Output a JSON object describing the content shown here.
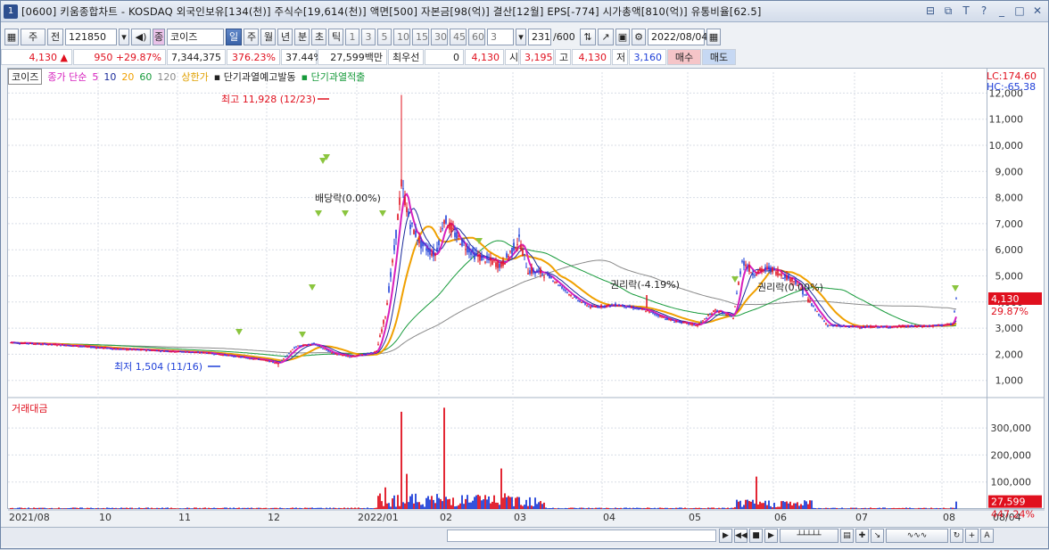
{
  "window": {
    "title": "[0600] 키움종합차트 - KOSDAQ 외국인보유[134(천)] 주식수[19,614(천)] 액면[500] 자본금[98(억)] 결산[12월] EPS[-774] 시가총액[810(억)] 유통비율[62.5]",
    "window_index": "1",
    "buttons": [
      "⊟",
      "⧉",
      "T",
      "?",
      "_",
      "□",
      "✕"
    ]
  },
  "toolbar": {
    "period_select": "주",
    "all_label": "전",
    "code": "121850",
    "market_badge": "종",
    "name": "코이즈",
    "tabs": [
      "일",
      "주",
      "월",
      "년",
      "분",
      "초",
      "틱"
    ],
    "active_tab": "일",
    "intervals": [
      "1",
      "3",
      "5",
      "10",
      "15",
      "30",
      "45",
      "60"
    ],
    "interval_value": "3",
    "count": "231",
    "count_total": "/600",
    "date": "2022/08/04"
  },
  "quote": {
    "price": "4,130",
    "change": "950",
    "change_pct": "+29.87%",
    "volume": "7,344,375",
    "vol_ratio": "376.23%",
    "turnover": "37.44%",
    "amount": "27,599백만",
    "pref_label": "최우선",
    "pref_value": "0",
    "price2": "4,130",
    "open_label": "시",
    "open": "3,195",
    "high_label": "고",
    "high": "4,130",
    "low_label": "저",
    "low": "3,160",
    "buy_label": "매수",
    "sell_label": "매도"
  },
  "legend": {
    "name": "코이즈",
    "ma_label": "종가 단순",
    "ma": [
      "5",
      "10",
      "20",
      "60",
      "120"
    ],
    "limit_up": "상한가",
    "warn1": "단기과열예고발동",
    "warn2": "단기과열적출"
  },
  "price_axis": {
    "lc": "LC:174.60",
    "hc": "HC:-65.38",
    "ticks": [
      "12,000",
      "11,000",
      "10,000",
      "9,000",
      "8,000",
      "7,000",
      "6,000",
      "5,000",
      "4,000",
      "3,000",
      "2,000",
      "1,000"
    ],
    "current": "4,130",
    "current_pct": "29.87%"
  },
  "volume_axis": {
    "label": "거래대금",
    "ticks": [
      "300,000",
      "200,000",
      "100,000"
    ],
    "current": "27,599",
    "current_pct": "447.24%"
  },
  "x_axis": {
    "labels": [
      "2021/08",
      "10",
      "11",
      "12",
      "2022/01",
      "02",
      "03",
      "04",
      "05",
      "06",
      "07",
      "08"
    ],
    "end_label": "08/04"
  },
  "annotations": {
    "high": "최고 11,928 (12/23)",
    "low": "최저 1,504 (11/16)",
    "dividend": "배당락(0.00%)",
    "rights": "권리락(-4.19%)",
    "rights2": "권리락(0.00%)"
  },
  "colors": {
    "up": "#e0101e",
    "down": "#1e3fd8",
    "ma5": "#d61fbd",
    "ma10": "#1a2a9a",
    "ma20": "#f0a000",
    "ma60": "#169a3a",
    "ma120": "#8a8a8a"
  }
}
